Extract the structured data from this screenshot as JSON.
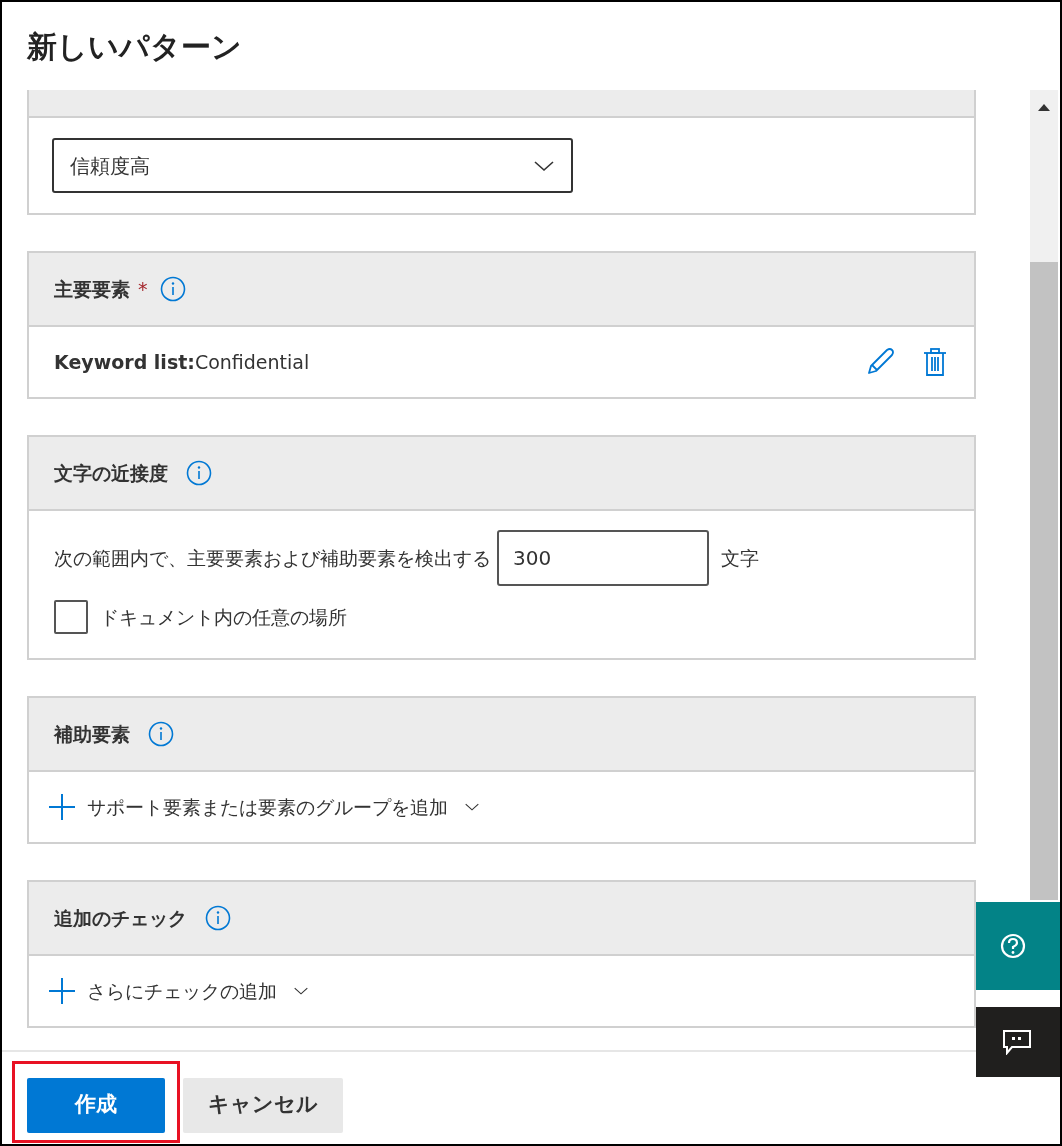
{
  "window": {
    "title": "新しいパターン"
  },
  "sections": [
    {
      "kind": "dropdown",
      "value": "信頼度高"
    },
    {
      "kind": "keyword",
      "heading": "主要要素",
      "required_mark": "*",
      "label": "Keyword list:",
      "value": "Confidential"
    },
    {
      "kind": "proximity",
      "heading": "文字の近接度",
      "text": "次の範囲内で、主要要素および補助要素を検出する",
      "value": "300",
      "unit": "文字",
      "checkbox": {
        "label": "ドキュメント内の任意の場所",
        "checked": false
      }
    },
    {
      "kind": "add",
      "heading": "補助要素",
      "action": "サポート要素または要素のグループを追加"
    },
    {
      "kind": "add",
      "heading": "追加のチェック",
      "action": "さらにチェックの追加"
    }
  ],
  "buttons": [
    {
      "label": "作成",
      "kind": "primary",
      "highlighted": true
    },
    {
      "label": "キャンセル",
      "kind": "secondary",
      "highlighted": false
    }
  ]
}
